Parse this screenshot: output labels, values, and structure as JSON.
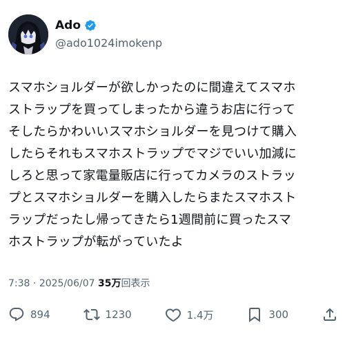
{
  "author": {
    "display_name": "Ado",
    "handle": "@ado1024imokenp",
    "avatar_icon": "avatar-icon",
    "verified_icon": "verified-badge-icon",
    "verified_color": "#1d9bf0"
  },
  "tweet": {
    "lines": [
      "スマホショルダーが欲しかったのに間違えてスマホ",
      "ストラップを買ってしまったから違うお店に行って",
      "そしたらかわいいスマホショルダーを見つけて購入",
      "したらそれもスマホストラップでマジでいい加減に",
      "しろと思って家電量販店に行ってカメラのストラッ",
      "プとスマホショルダーを購入したらまたスマホスト",
      "ラップだったし帰ってきたら1週間前に買ったスマ",
      "ホストラップが転がっていたよ"
    ]
  },
  "meta": {
    "time": "7:38",
    "separator": "·",
    "date": "2025/06/07",
    "views": "35万",
    "views_label": "回表示"
  },
  "actions": {
    "reply": {
      "icon": "reply-icon",
      "count": "894"
    },
    "retweet": {
      "icon": "retweet-icon",
      "count": "1230"
    },
    "like": {
      "icon": "heart-icon",
      "count": "1.4万"
    },
    "bookmark": {
      "icon": "bookmark-icon",
      "count": "300"
    },
    "share": {
      "icon": "share-icon"
    }
  },
  "colors": {
    "text": "#0f1419",
    "secondary": "#536471",
    "verified": "#1d9bf0"
  }
}
